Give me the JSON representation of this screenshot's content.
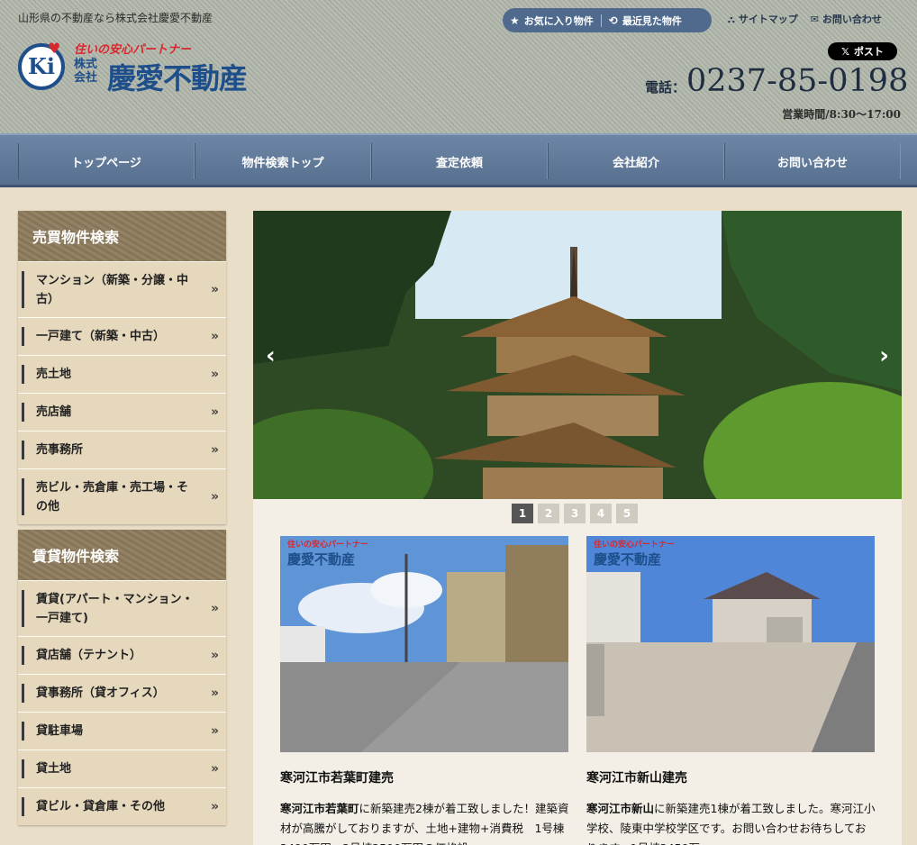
{
  "header": {
    "tagline": "山形県の不動産なら株式会社慶愛不動産",
    "logo_partner": "住いの安心パートナー",
    "logo_kaisha": "株式会社",
    "logo_name": "慶愛不動産",
    "logo_mark": "Ki",
    "favorites_label": "お気に入り物件",
    "recent_label": "最近見た物件",
    "sitemap_label": "サイトマップ",
    "contact_label": "お問い合わせ",
    "x_post_label": "ポスト",
    "tel_label": "電話：",
    "tel": "0237-85-0198",
    "hours": "営業時間/8:30～17:00"
  },
  "nav": [
    "トップページ",
    "物件検索トップ",
    "査定依頼",
    "会社紹介",
    "お問い合わせ"
  ],
  "sidebar": {
    "sale_title": "売買物件検索",
    "sale_items": [
      "マンション（新築・分譲・中古）",
      "一戸建て（新築・中古）",
      "売土地",
      "売店舗",
      "売事務所",
      "売ビル・売倉庫・売工場・その他"
    ],
    "rent_title": "賃貸物件検索",
    "rent_items": [
      "賃貸(アパート・マンション・一戸建て)",
      "貸店舗（テナント）",
      "貸事務所（貸オフィス）",
      "貸駐車場",
      "貸土地",
      "貸ビル・貸倉庫・その他"
    ]
  },
  "slider": {
    "prev": "‹",
    "next": "›",
    "pages": [
      "1",
      "2",
      "3",
      "4",
      "5"
    ],
    "active_page": 1
  },
  "cards": [
    {
      "title": "寒河江市若葉町建売",
      "lead": "寒河江市若葉町",
      "body": "に新築建売2棟が着工致しました！建築資材が高騰がしておりますが、土地+建物+消費税　1号棟2490万円、2号棟2590万円の価格設"
    },
    {
      "title": "寒河江市新山建売",
      "lead": "寒河江市新山",
      "body": "に新築建売1棟が着工致しました。寒河江小学校、陵東中学校学区です。お問い合わせお待ちしております。1号棟2450万"
    }
  ],
  "colors": {
    "brand_blue": "#1e4f8a",
    "brand_red": "#d9272e",
    "nav_blue": "#57708f",
    "sidebar_head": "#8c7a5c"
  }
}
